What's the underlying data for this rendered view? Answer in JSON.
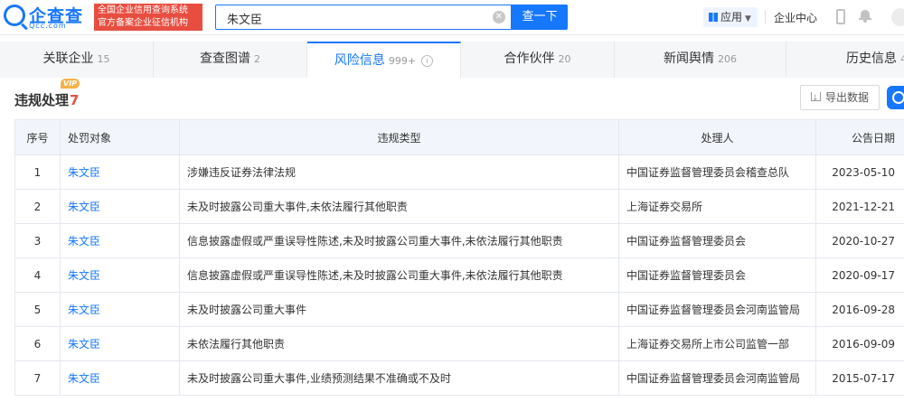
{
  "header": {
    "logo_text": "企查查",
    "logo_sub": "Qcc.com",
    "slogan_line1": "全国企业信用查询系统",
    "slogan_line2": "官方备案企业征信机构",
    "search_value": "朱文臣",
    "search_button": "查一下",
    "app_label": "应用",
    "enterprise_center": "企业中心"
  },
  "tabs": [
    {
      "label": "关联企业",
      "count": "15"
    },
    {
      "label": "查查图谱",
      "count": "2"
    },
    {
      "label": "风险信息",
      "count": "999+"
    },
    {
      "label": "合作伙伴",
      "count": "20"
    },
    {
      "label": "新闻舆情",
      "count": "206"
    },
    {
      "label": "历史信息",
      "count": "4"
    }
  ],
  "section": {
    "title": "违规处理",
    "count": "7",
    "vip_badge": "VIP",
    "export_label": "导出数据"
  },
  "table": {
    "columns": [
      "序号",
      "处罚对象",
      "违规类型",
      "处理人",
      "公告日期"
    ],
    "rows": [
      {
        "seq": "1",
        "target": "朱文臣",
        "type": "涉嫌违反证券法律法规",
        "handler": "中国证券监督管理委员会稽查总队",
        "date": "2023-05-10"
      },
      {
        "seq": "2",
        "target": "朱文臣",
        "type": "未及时披露公司重大事件,未依法履行其他职责",
        "handler": "上海证券交易所",
        "date": "2021-12-21"
      },
      {
        "seq": "3",
        "target": "朱文臣",
        "type": "信息披露虚假或严重误导性陈述,未及时披露公司重大事件,未依法履行其他职责",
        "handler": "中国证券监督管理委员会",
        "date": "2020-10-27"
      },
      {
        "seq": "4",
        "target": "朱文臣",
        "type": "信息披露虚假或严重误导性陈述,未及时披露公司重大事件,未依法履行其他职责",
        "handler": "中国证券监督管理委员会",
        "date": "2020-09-17"
      },
      {
        "seq": "5",
        "target": "朱文臣",
        "type": "未及时披露公司重大事件",
        "handler": "中国证券监督管理委员会河南监管局",
        "date": "2016-09-28"
      },
      {
        "seq": "6",
        "target": "朱文臣",
        "type": "未依法履行其他职责",
        "handler": "上海证券交易所上市公司监管一部",
        "date": "2016-09-09"
      },
      {
        "seq": "7",
        "target": "朱文臣",
        "type": "未及时披露公司重大事件,业绩预测结果不准确或不及时",
        "handler": "中国证券监督管理委员会河南监管局",
        "date": "2015-07-17"
      }
    ]
  }
}
